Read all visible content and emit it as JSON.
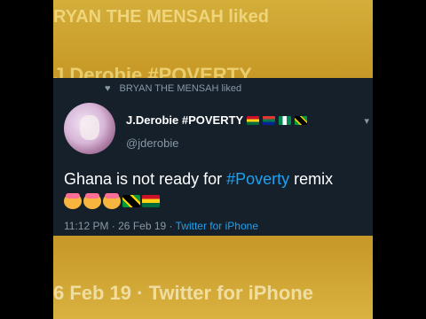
{
  "background": {
    "top_text": "RYAN THE MENSAH liked",
    "mid_text": "J.Derobie #POVERTY",
    "bottom_text": "6 Feb 19 · Twitter for iPhone"
  },
  "tweet": {
    "liked_by": "BRYAN THE MENSAH liked",
    "display_name": "J.Derobie #POVERTY",
    "handle": "@jderobie",
    "text_before": "Ghana is not ready for ",
    "hashtag": "#Poverty",
    "text_after": " remix",
    "time": "11:12 PM · 26 Feb 19 · ",
    "source": "Twitter for iPhone"
  },
  "icons": {
    "heart": "heart-icon",
    "chevron": "chevron-down-icon"
  },
  "colors": {
    "tweet_bg": "#15202b",
    "accent": "#1da1f2",
    "secondary_text": "#8899a6",
    "gold_bg": "#c89a28"
  }
}
